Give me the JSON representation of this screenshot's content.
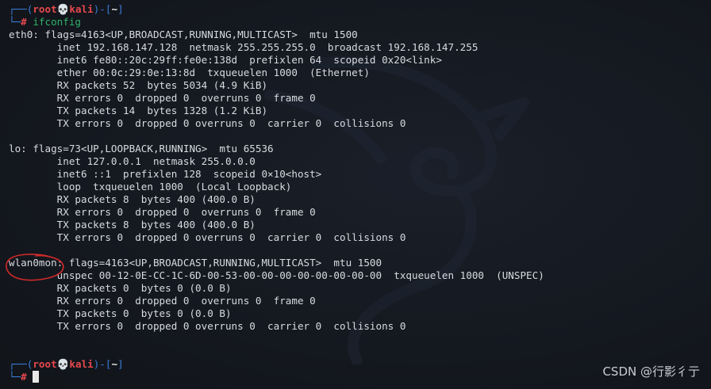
{
  "prompt": {
    "corner_top": "┌──(",
    "user": "root",
    "skull": "💀",
    "host": "kali",
    "mid": ")-[",
    "dir": "~",
    "end": "]",
    "corner_bottom": "└─",
    "hash": "# "
  },
  "command": "ifconfig",
  "output_lines": [
    "eth0: flags=4163<UP,BROADCAST,RUNNING,MULTICAST>  mtu 1500",
    "        inet 192.168.147.128  netmask 255.255.255.0  broadcast 192.168.147.255",
    "        inet6 fe80::20c:29ff:fe0e:138d  prefixlen 64  scopeid 0x20<link>",
    "        ether 00:0c:29:0e:13:8d  txqueuelen 1000  (Ethernet)",
    "        RX packets 52  bytes 5034 (4.9 KiB)",
    "        RX errors 0  dropped 0  overruns 0  frame 0",
    "        TX packets 14  bytes 1328 (1.2 KiB)",
    "        TX errors 0  dropped 0 overruns 0  carrier 0  collisions 0",
    "",
    "lo: flags=73<UP,LOOPBACK,RUNNING>  mtu 65536",
    "        inet 127.0.0.1  netmask 255.0.0.0",
    "        inet6 ::1  prefixlen 128  scopeid 0×10<host>",
    "        loop  txqueuelen 1000  (Local Loopback)",
    "        RX packets 8  bytes 400 (400.0 B)",
    "        RX errors 0  dropped 0  overruns 0  frame 0",
    "        TX packets 8  bytes 400 (400.0 B)",
    "        TX errors 0  dropped 0 overruns 0  carrier 0  collisions 0",
    "",
    "wlan0mon: flags=4163<UP,BROADCAST,RUNNING,MULTICAST>  mtu 1500",
    "        unspec 00-12-0E-CC-1C-6D-00-53-00-00-00-00-00-00-00-00  txqueuelen 1000  (UNSPEC)",
    "        RX packets 0  bytes 0 (0.0 B)",
    "        RX errors 0  dropped 0  overruns 0  frame 0",
    "        TX packets 0  bytes 0 (0.0 B)",
    "        TX errors 0  dropped 0 overruns 0  carrier 0  collisions 0",
    "",
    ""
  ],
  "watermark": "CSDN @行影彳亍",
  "colors": {
    "background": "#13171e",
    "prompt_blue": "#3b7bd6",
    "prompt_red": "#e5484d",
    "command_green": "#2fb16a",
    "annotation_red": "#d42a2a"
  }
}
